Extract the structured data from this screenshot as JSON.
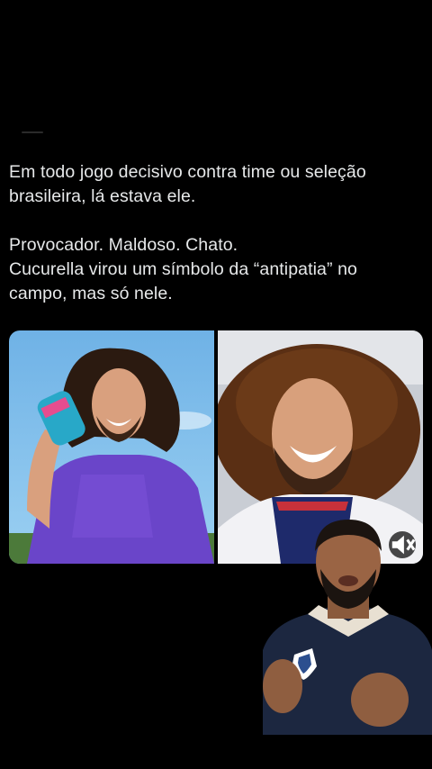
{
  "post": {
    "paragraphs": [
      "Em todo jogo decisivo contra time ou seleção brasileira, lá estava ele.",
      "Provocador. Maldoso. Chato.\nCucurella virou um símbolo da “antipatia” no campo, mas só nele."
    ]
  },
  "media": {
    "left_photo": "player-drinking-photo",
    "right_photo": "player-smiling-photo",
    "mute_icon": "speaker-muted-icon"
  },
  "overlay": {
    "presenter": "commentator-video-overlay"
  },
  "colors": {
    "background": "#000000",
    "text": "#e7e9ea"
  }
}
